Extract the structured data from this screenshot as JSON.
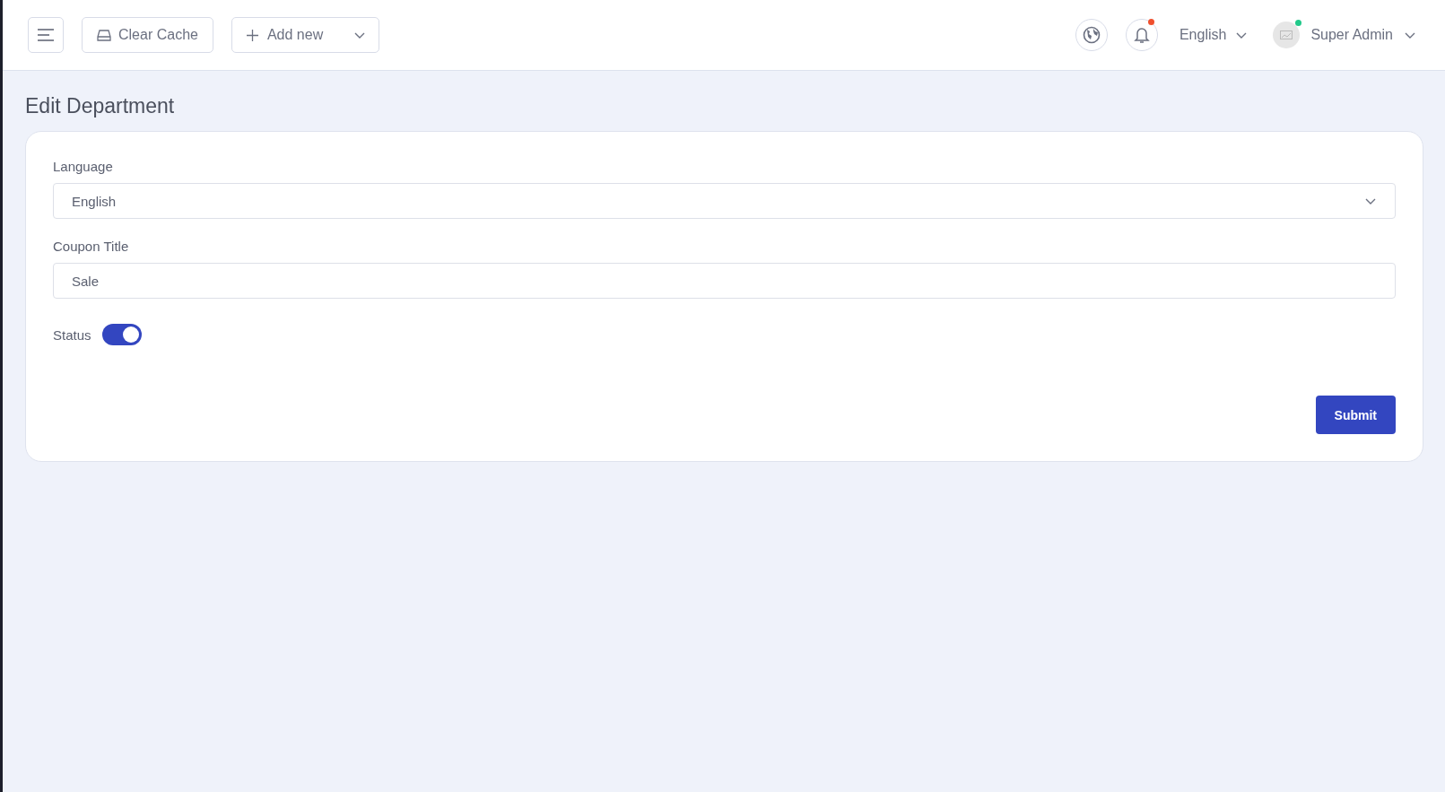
{
  "header": {
    "clear_cache": "Clear Cache",
    "add_new": "Add new",
    "notifications": {
      "unread": true
    },
    "language": "English",
    "user": {
      "name": "Super Admin",
      "online": true
    }
  },
  "page_title": "Edit Department",
  "form": {
    "fields": [
      {
        "kind": "select",
        "label": "Language",
        "value": "English"
      },
      {
        "kind": "text",
        "label": "Coupon Title",
        "value": "Sale"
      },
      {
        "kind": "toggle",
        "label": "Status",
        "on": true
      }
    ],
    "submit": "Submit"
  }
}
